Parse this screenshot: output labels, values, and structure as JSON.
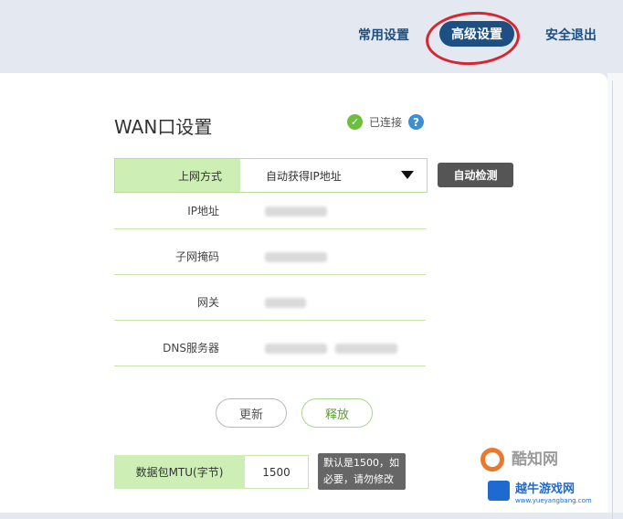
{
  "nav": {
    "common_settings": "常用设置",
    "advanced_settings": "高级设置",
    "logout": "安全退出"
  },
  "wan": {
    "title": "WAN口设置",
    "status_text": "已连接",
    "status_icon": "check-circle-icon",
    "help_icon": "question-icon",
    "connection_label": "上网方式",
    "connection_value": "自动获得IP地址",
    "detect_button": "自动检测",
    "fields": [
      {
        "label": "IP地址"
      },
      {
        "label": "子网掩码"
      },
      {
        "label": "网关"
      },
      {
        "label": "DNS服务器"
      }
    ],
    "refresh_button": "更新",
    "release_button": "释放",
    "mtu_label": "数据包MTU(字节)",
    "mtu_value": "1500",
    "mtu_tip_line1": "默认是1500，如",
    "mtu_tip_line2": "必要，请勿修改"
  },
  "watermark": {
    "text1": "酷知网",
    "text2": "越牛游戏网",
    "text3": "www.yueyangbang.com"
  },
  "colors": {
    "nav_text": "#1d4f83",
    "label_bg": "#cdeeb4",
    "annotation": "#d7262f"
  }
}
